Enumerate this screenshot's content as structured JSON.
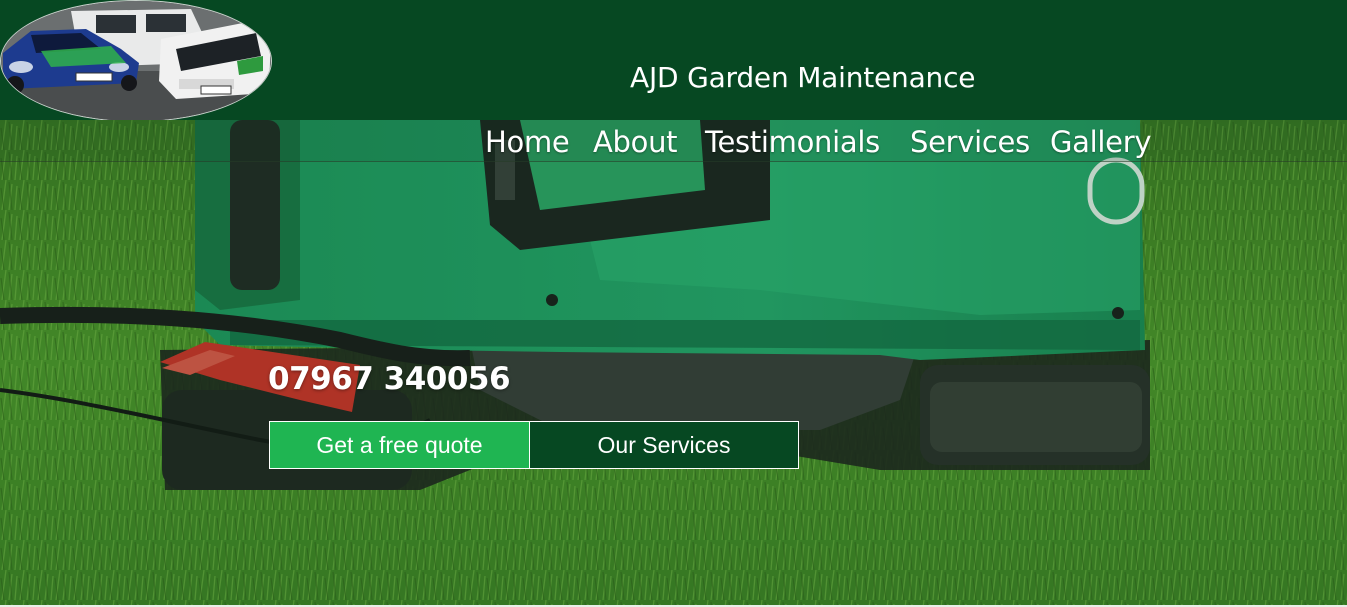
{
  "header": {
    "logo_icon": "vans-photo-logo",
    "title": "AJD Garden Maintenance",
    "background_color": "#064822"
  },
  "nav": {
    "items": [
      {
        "label": "Home"
      },
      {
        "label": "About"
      },
      {
        "label": "Testimonials"
      },
      {
        "label": "Services"
      },
      {
        "label": "Gallery"
      }
    ]
  },
  "hero": {
    "background_image": "lawn-mower-on-grass",
    "phone": "07967 340056",
    "buttons": {
      "quote_label": "Get a free quote",
      "services_label": "Our Services"
    },
    "accent_color": "#1fb552"
  }
}
